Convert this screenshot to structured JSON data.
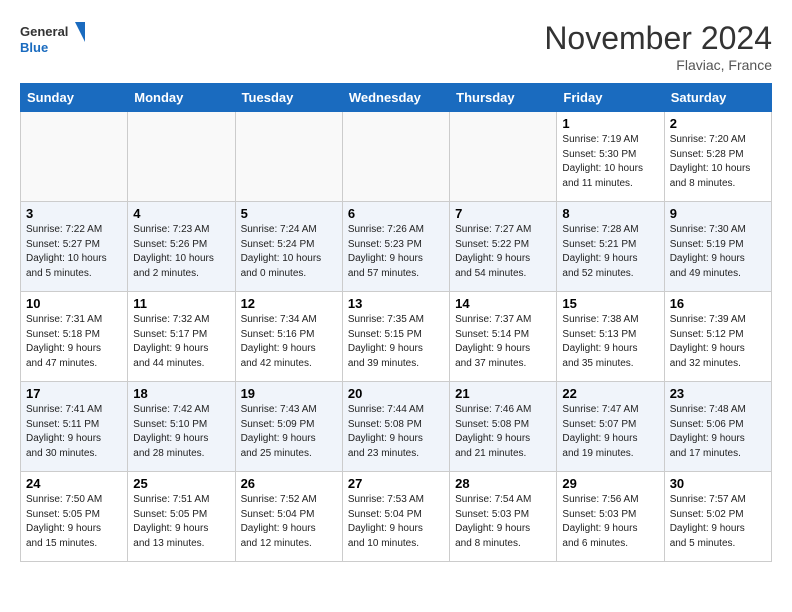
{
  "header": {
    "logo_line1": "General",
    "logo_line2": "Blue",
    "month_title": "November 2024",
    "location": "Flaviac, France"
  },
  "weekdays": [
    "Sunday",
    "Monday",
    "Tuesday",
    "Wednesday",
    "Thursday",
    "Friday",
    "Saturday"
  ],
  "weeks": [
    [
      {
        "day": "",
        "info": ""
      },
      {
        "day": "",
        "info": ""
      },
      {
        "day": "",
        "info": ""
      },
      {
        "day": "",
        "info": ""
      },
      {
        "day": "",
        "info": ""
      },
      {
        "day": "1",
        "info": "Sunrise: 7:19 AM\nSunset: 5:30 PM\nDaylight: 10 hours\nand 11 minutes."
      },
      {
        "day": "2",
        "info": "Sunrise: 7:20 AM\nSunset: 5:28 PM\nDaylight: 10 hours\nand 8 minutes."
      }
    ],
    [
      {
        "day": "3",
        "info": "Sunrise: 7:22 AM\nSunset: 5:27 PM\nDaylight: 10 hours\nand 5 minutes."
      },
      {
        "day": "4",
        "info": "Sunrise: 7:23 AM\nSunset: 5:26 PM\nDaylight: 10 hours\nand 2 minutes."
      },
      {
        "day": "5",
        "info": "Sunrise: 7:24 AM\nSunset: 5:24 PM\nDaylight: 10 hours\nand 0 minutes."
      },
      {
        "day": "6",
        "info": "Sunrise: 7:26 AM\nSunset: 5:23 PM\nDaylight: 9 hours\nand 57 minutes."
      },
      {
        "day": "7",
        "info": "Sunrise: 7:27 AM\nSunset: 5:22 PM\nDaylight: 9 hours\nand 54 minutes."
      },
      {
        "day": "8",
        "info": "Sunrise: 7:28 AM\nSunset: 5:21 PM\nDaylight: 9 hours\nand 52 minutes."
      },
      {
        "day": "9",
        "info": "Sunrise: 7:30 AM\nSunset: 5:19 PM\nDaylight: 9 hours\nand 49 minutes."
      }
    ],
    [
      {
        "day": "10",
        "info": "Sunrise: 7:31 AM\nSunset: 5:18 PM\nDaylight: 9 hours\nand 47 minutes."
      },
      {
        "day": "11",
        "info": "Sunrise: 7:32 AM\nSunset: 5:17 PM\nDaylight: 9 hours\nand 44 minutes."
      },
      {
        "day": "12",
        "info": "Sunrise: 7:34 AM\nSunset: 5:16 PM\nDaylight: 9 hours\nand 42 minutes."
      },
      {
        "day": "13",
        "info": "Sunrise: 7:35 AM\nSunset: 5:15 PM\nDaylight: 9 hours\nand 39 minutes."
      },
      {
        "day": "14",
        "info": "Sunrise: 7:37 AM\nSunset: 5:14 PM\nDaylight: 9 hours\nand 37 minutes."
      },
      {
        "day": "15",
        "info": "Sunrise: 7:38 AM\nSunset: 5:13 PM\nDaylight: 9 hours\nand 35 minutes."
      },
      {
        "day": "16",
        "info": "Sunrise: 7:39 AM\nSunset: 5:12 PM\nDaylight: 9 hours\nand 32 minutes."
      }
    ],
    [
      {
        "day": "17",
        "info": "Sunrise: 7:41 AM\nSunset: 5:11 PM\nDaylight: 9 hours\nand 30 minutes."
      },
      {
        "day": "18",
        "info": "Sunrise: 7:42 AM\nSunset: 5:10 PM\nDaylight: 9 hours\nand 28 minutes."
      },
      {
        "day": "19",
        "info": "Sunrise: 7:43 AM\nSunset: 5:09 PM\nDaylight: 9 hours\nand 25 minutes."
      },
      {
        "day": "20",
        "info": "Sunrise: 7:44 AM\nSunset: 5:08 PM\nDaylight: 9 hours\nand 23 minutes."
      },
      {
        "day": "21",
        "info": "Sunrise: 7:46 AM\nSunset: 5:08 PM\nDaylight: 9 hours\nand 21 minutes."
      },
      {
        "day": "22",
        "info": "Sunrise: 7:47 AM\nSunset: 5:07 PM\nDaylight: 9 hours\nand 19 minutes."
      },
      {
        "day": "23",
        "info": "Sunrise: 7:48 AM\nSunset: 5:06 PM\nDaylight: 9 hours\nand 17 minutes."
      }
    ],
    [
      {
        "day": "24",
        "info": "Sunrise: 7:50 AM\nSunset: 5:05 PM\nDaylight: 9 hours\nand 15 minutes."
      },
      {
        "day": "25",
        "info": "Sunrise: 7:51 AM\nSunset: 5:05 PM\nDaylight: 9 hours\nand 13 minutes."
      },
      {
        "day": "26",
        "info": "Sunrise: 7:52 AM\nSunset: 5:04 PM\nDaylight: 9 hours\nand 12 minutes."
      },
      {
        "day": "27",
        "info": "Sunrise: 7:53 AM\nSunset: 5:04 PM\nDaylight: 9 hours\nand 10 minutes."
      },
      {
        "day": "28",
        "info": "Sunrise: 7:54 AM\nSunset: 5:03 PM\nDaylight: 9 hours\nand 8 minutes."
      },
      {
        "day": "29",
        "info": "Sunrise: 7:56 AM\nSunset: 5:03 PM\nDaylight: 9 hours\nand 6 minutes."
      },
      {
        "day": "30",
        "info": "Sunrise: 7:57 AM\nSunset: 5:02 PM\nDaylight: 9 hours\nand 5 minutes."
      }
    ]
  ]
}
